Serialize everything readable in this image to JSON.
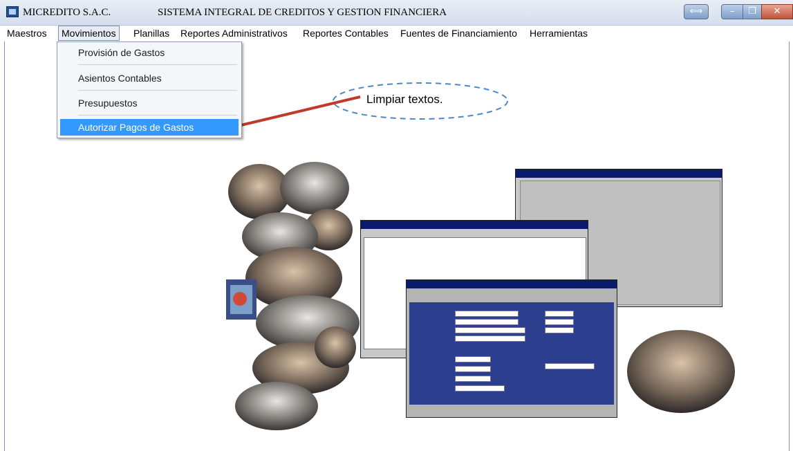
{
  "window": {
    "app_name": "MICREDITO S.A.C.",
    "system_title": "SISTEMA INTEGRAL DE CREDITOS Y GESTION FINANCIERA",
    "buttons": [
      "⟺",
      "–",
      "❐",
      "✕"
    ]
  },
  "menubar": {
    "items": [
      "Maestros",
      "Movimientos",
      "Planillas",
      "Reportes Administrativos",
      "Reportes Contables",
      "Fuentes de Financiamiento",
      "Herramientas"
    ]
  },
  "dropdown": {
    "items": [
      "Provisión de Gastos",
      "Asientos Contables",
      "Presupuestos",
      "Autorizar Pagos de Gastos"
    ]
  },
  "callout": {
    "text": "Limpiar textos."
  },
  "colors": {
    "accent": "#3399ff",
    "arrow": "#c0392b",
    "callout_border": "#4a86c8",
    "window_blue": "#0c1a6b"
  }
}
